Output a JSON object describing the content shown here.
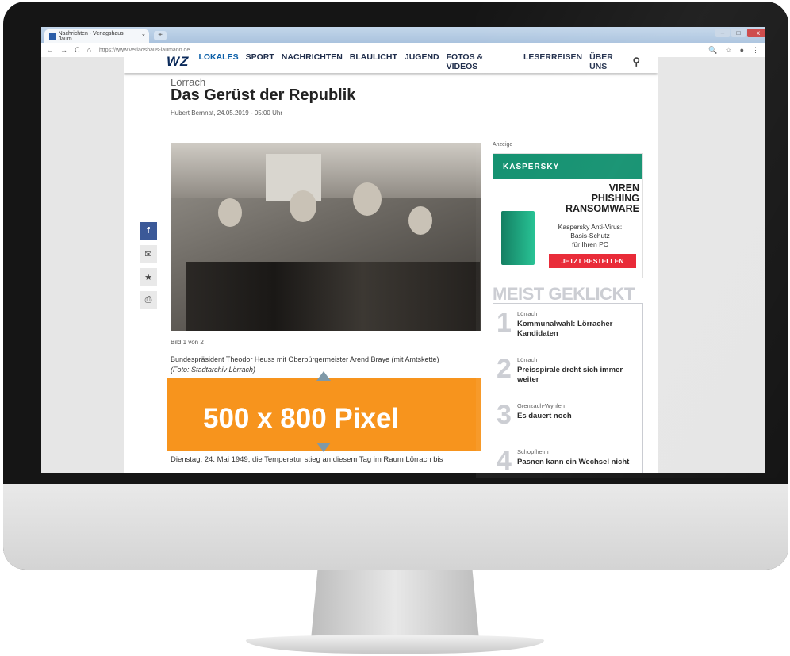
{
  "browser": {
    "tab_title": "Nachrichten - Verlagshaus Jaum...",
    "tab_close": "×",
    "new_tab": "+",
    "url": "https://www.verlagshaus-jaumann.de",
    "nav_back": "←",
    "nav_forward": "→",
    "nav_reload": "C",
    "nav_home": "⌂",
    "zoom_icon": "🔍",
    "bookmark_icon": "☆",
    "profile_icon": "●",
    "menu_icon": "⋮",
    "win_min": "–",
    "win_max": "□",
    "win_close": "x"
  },
  "site": {
    "logo": "WZ",
    "nav_items": [
      "LOKALES",
      "SPORT",
      "NACHRICHTEN",
      "BLAULICHT",
      "JUGEND",
      "FOTOS & VIDEOS",
      "LESERREISEN",
      "ÜBER UNS"
    ],
    "search_icon": "⚲"
  },
  "article": {
    "location": "Lörrach",
    "headline": "Das Gerüst der Republik",
    "byline": "Hubert Bernnat,  24.05.2019 - 05:00 Uhr",
    "image_counter": "Bild 1 von 2",
    "caption_text": "Bundespräsident Theodor Heuss mit Oberbürgermeister Arend Braye (mit Amtskette)",
    "caption_credit": "(Foto: Stadtarchiv Lörrach)",
    "body_start": "Dienstag, 24. Mai 1949, die Temperatur stieg an diesem Tag im Raum Lörrach bis"
  },
  "overlay": {
    "label": "500 x 800 Pixel",
    "color": "#f7941d"
  },
  "social": {
    "facebook": "f",
    "mail": "✉",
    "star": "★",
    "print": "⎙"
  },
  "ad": {
    "label": "Anzeige",
    "brand": "KASPERSKY",
    "headline_1": "VIREN",
    "headline_2": "PHISHING",
    "headline_3": "RANSOMWARE",
    "sub_1": "Kaspersky Anti-Virus:",
    "sub_2": "Basis-Schutz",
    "sub_3": "für Ihren PC",
    "cta": "JETZT BESTELLEN"
  },
  "most_clicked": {
    "title": "MEIST GEKLICKT",
    "items": [
      {
        "num": "1",
        "location": "Lörrach",
        "title": "Kommunalwahl: Lörracher Kandidaten"
      },
      {
        "num": "2",
        "location": "Lörrach",
        "title": "Preisspirale dreht sich immer weiter"
      },
      {
        "num": "3",
        "location": "Grenzach-Wyhlen",
        "title": "Es dauert noch"
      },
      {
        "num": "4",
        "location": "Schopfheim",
        "title": "Pasnen kann ein Wechsel nicht"
      }
    ]
  }
}
